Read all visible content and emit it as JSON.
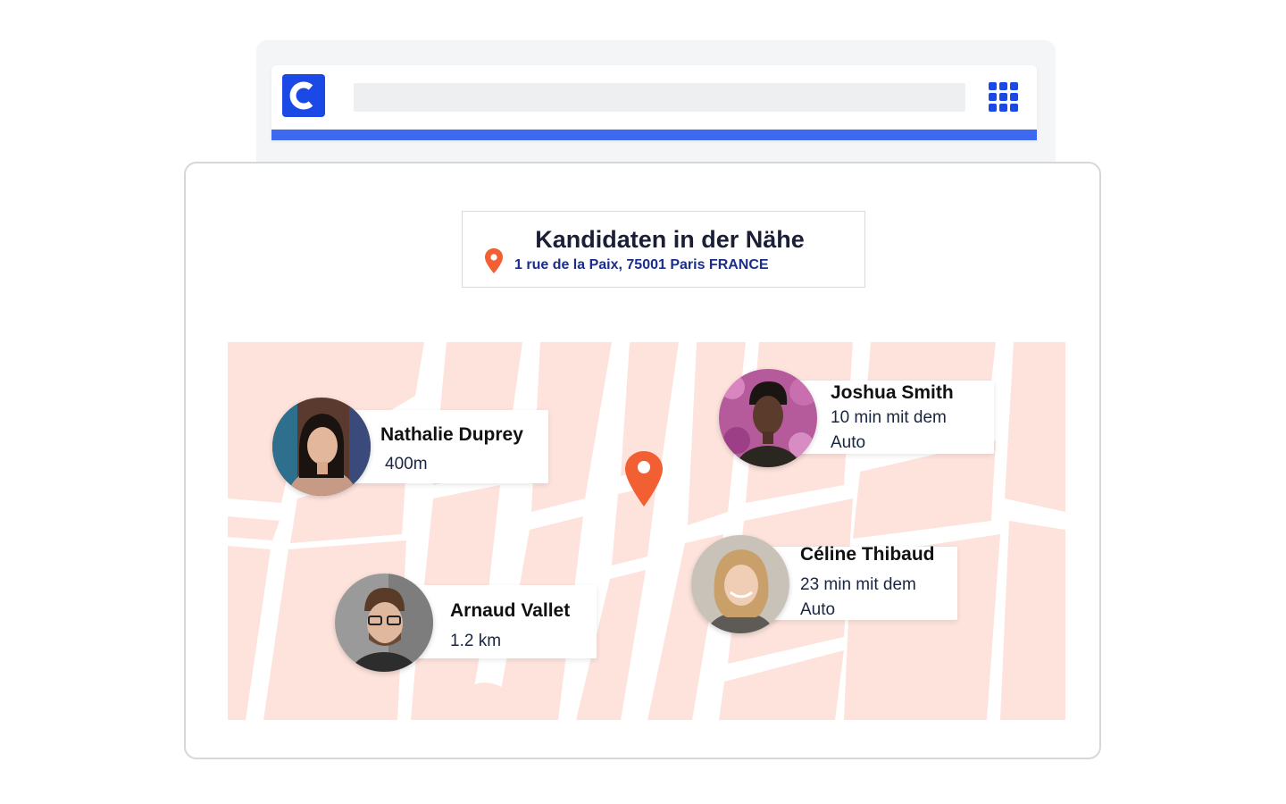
{
  "app": {
    "logo_letter": "C",
    "brand_color": "#1a49e6",
    "accent_color": "#3d6af0"
  },
  "header": {
    "title": "Kandidaten in der Nähe",
    "address": "1 rue de la Paix, 75001 Paris FRANCE",
    "pin_color": "#f25f33"
  },
  "map": {
    "block_color": "#fde3dc",
    "center_pin_icon": "location-pin-icon"
  },
  "candidates": [
    {
      "name": "Nathalie Duprey",
      "distance": "400m"
    },
    {
      "name": "Joshua Smith",
      "distance": "10 min mit dem Auto"
    },
    {
      "name": "Arnaud Vallet",
      "distance": "1.2 km"
    },
    {
      "name": "Céline Thibaud",
      "distance": "23 min mit dem Auto"
    }
  ]
}
